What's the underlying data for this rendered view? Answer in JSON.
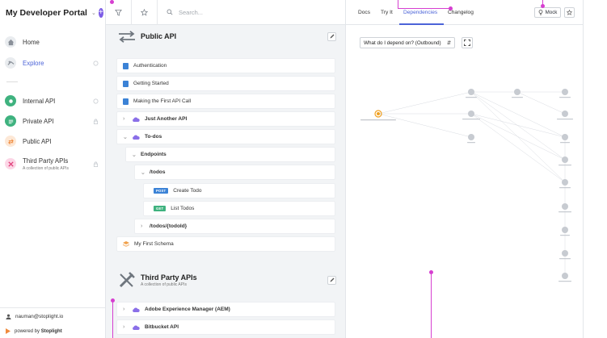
{
  "sidebar": {
    "portal_title": "My Developer Portal",
    "nav": [
      {
        "label": "Home",
        "icon": "home-icon"
      },
      {
        "label": "Explore",
        "icon": "explore-icon",
        "active": true
      }
    ],
    "projects": [
      {
        "label": "Internal API",
        "icon": "internal-api-icon"
      },
      {
        "label": "Private API",
        "icon": "private-api-icon"
      },
      {
        "label": "Public API",
        "icon": "public-api-icon"
      },
      {
        "label": "Third Party APIs",
        "sub": "A collection of public APIs",
        "icon": "third-party-icon"
      }
    ],
    "user": "nauman@stoplight.io",
    "powered_prefix": "powered by",
    "powered_brand": "Stoplight"
  },
  "toolbar": {
    "search_placeholder": "Search..."
  },
  "groups": {
    "public": {
      "title": "Public API"
    },
    "third": {
      "title": "Third Party APIs",
      "sub": "A collection of public APIs"
    }
  },
  "tree": {
    "authentication": "Authentication",
    "getting_started": "Getting Started",
    "first_call": "Making the First API Call",
    "just_another": "Just Another API",
    "todos": "To-dos",
    "endpoints": "Endpoints",
    "todos_path": "/todos",
    "create_method": "POST",
    "create_label": "Create Todo",
    "list_method": "GET",
    "list_label": "List Todos",
    "todo_id_path": "/todos/{todoId}",
    "schema": "My First Schema",
    "aem": "Adobe Experience Manager (AEM)",
    "bitbucket": "Bitbucket API"
  },
  "right": {
    "tabs": [
      "Docs",
      "Try It",
      "Dependencies",
      "Changelog"
    ],
    "active_tab": "Dependencies",
    "mock_label": "Mock",
    "dependency_select": "What do I depend on? (Outbound)"
  },
  "colors": {
    "accent": "#7c5ce6",
    "active_link": "#4b63d8",
    "annotation": "#d63fd0",
    "post": "#3b82d6",
    "get": "#3fb27f",
    "graph_root": "#f0a020"
  }
}
